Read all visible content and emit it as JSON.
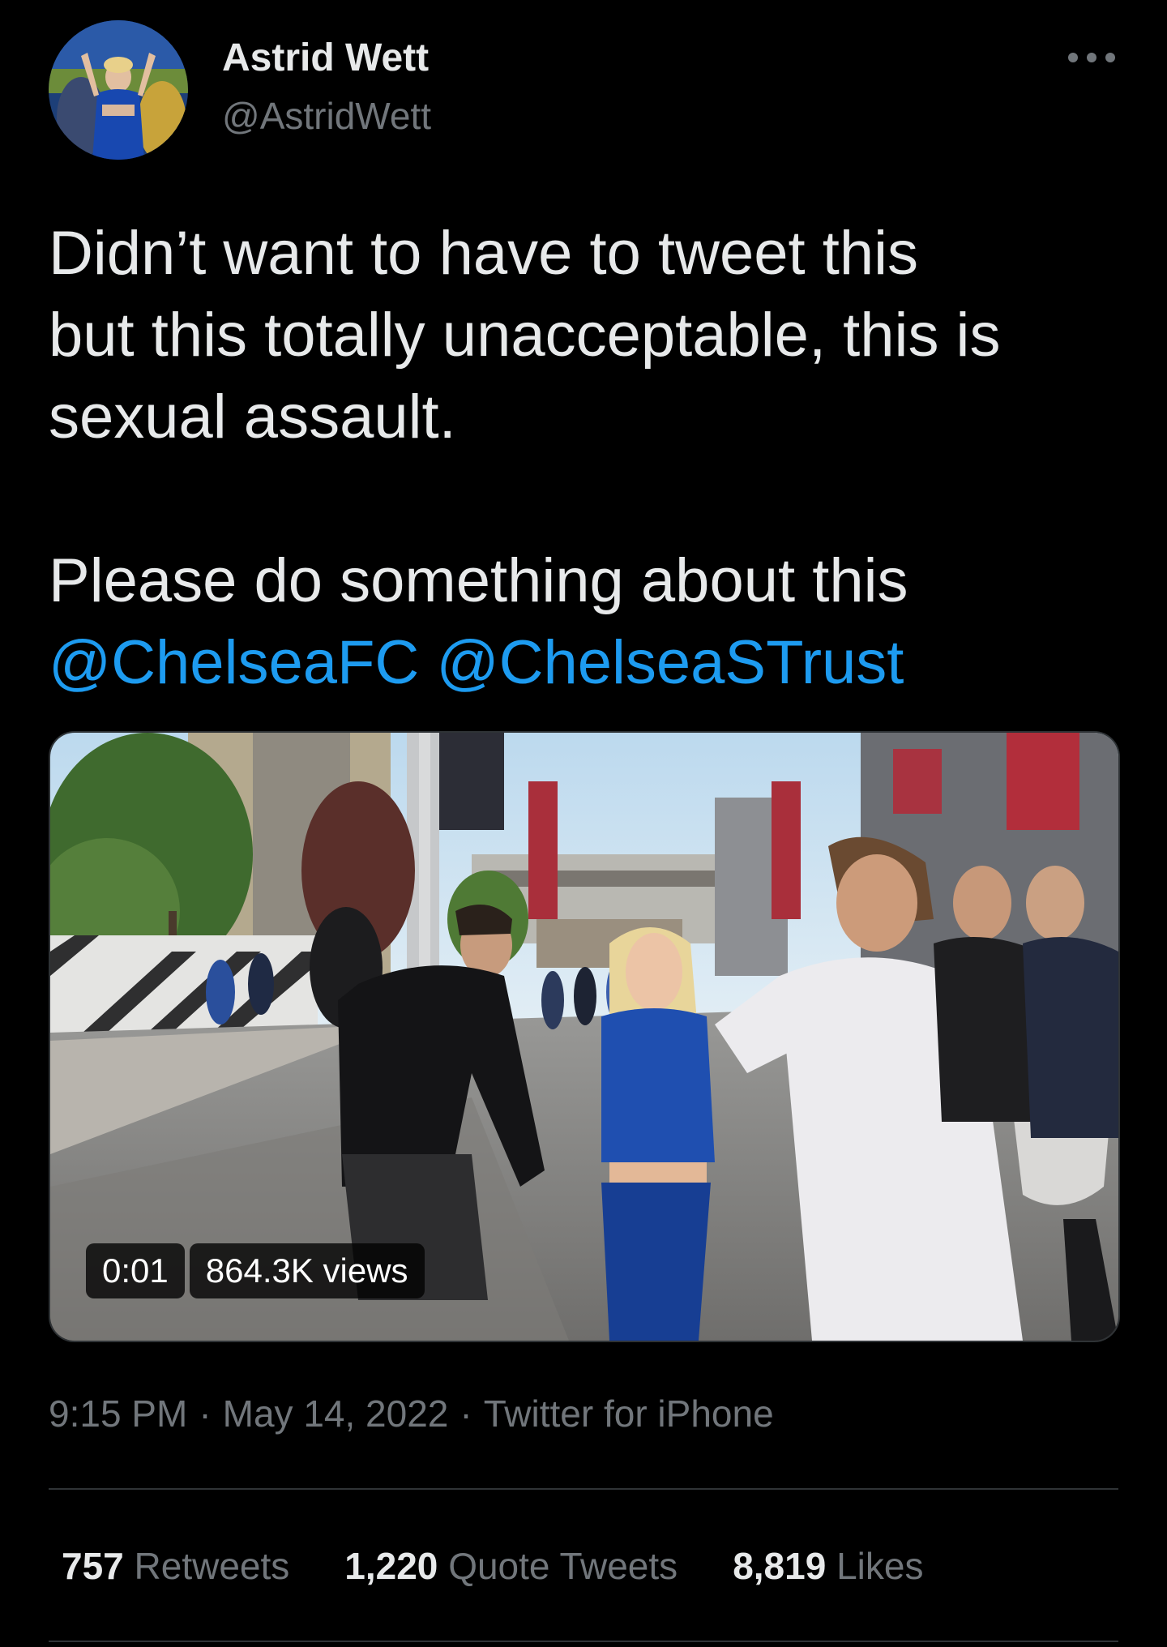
{
  "author": {
    "display_name": "Astrid Wett",
    "handle": "@AstridWett"
  },
  "tweet": {
    "line1": "Didn’t want to have to tweet this",
    "line2": "but this totally unacceptable, this is",
    "line3": "sexual assault.",
    "line4": "Please do something about this",
    "mentions": [
      "@ChelseaFC",
      "@ChelseaSTrust"
    ]
  },
  "media": {
    "duration": "0:01",
    "views": "864.3K views"
  },
  "meta": {
    "time": "9:15 PM",
    "date": "May 14, 2022",
    "source": "Twitter for iPhone",
    "separator": "·"
  },
  "stats": {
    "retweets_count": "757",
    "retweets_label": "Retweets",
    "quotes_count": "1,220",
    "quotes_label": "Quote Tweets",
    "likes_count": "8,819",
    "likes_label": "Likes"
  },
  "colors": {
    "background": "#000000",
    "text": "#e7e9ea",
    "secondary": "#71767b",
    "link": "#1d9bf0",
    "divider": "#2f3336"
  }
}
